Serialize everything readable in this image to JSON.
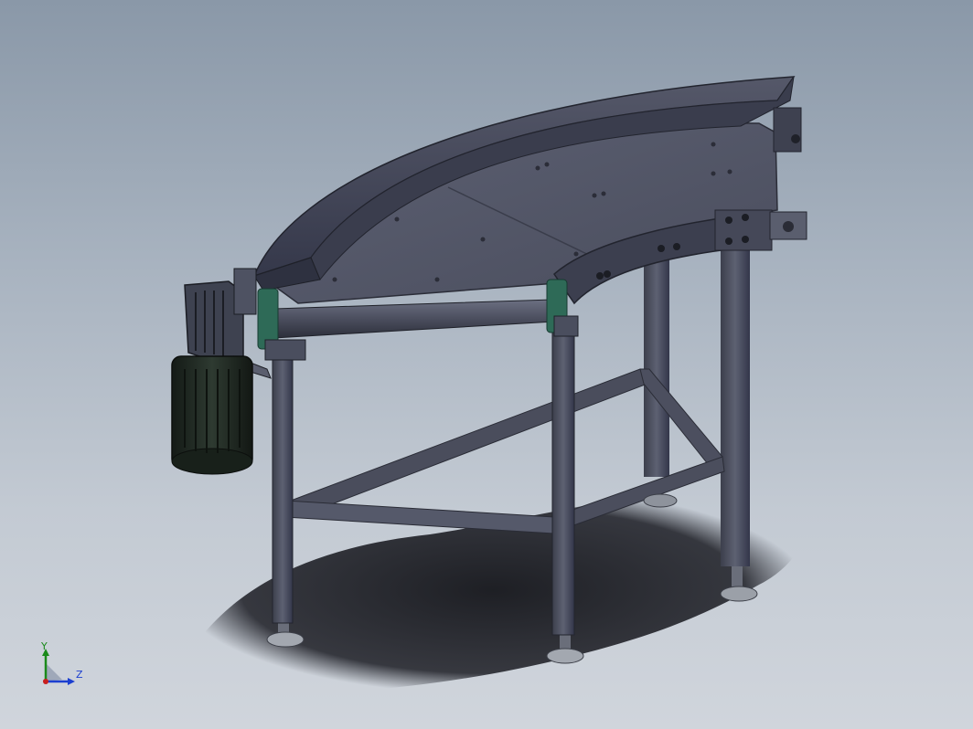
{
  "viewport": {
    "background_top": "#8a98a8",
    "background_bottom": "#d0d5dc"
  },
  "model": {
    "description_icon": "curved-belt-conveyor-model",
    "colors": {
      "frame": "#4a4e5e",
      "frame_dark": "#2e313c",
      "belt_surface": "#5a5e70",
      "guard_rail": "#3e4150",
      "motor": "#1f2a22",
      "bearing": "#2f6b5a",
      "shadow": "#1a1c22"
    }
  },
  "triad": {
    "y_label": "Y",
    "z_label": "Z",
    "y_color": "#1a8a1a",
    "z_color": "#1c3fd0",
    "x_color": "#c81e1e"
  }
}
